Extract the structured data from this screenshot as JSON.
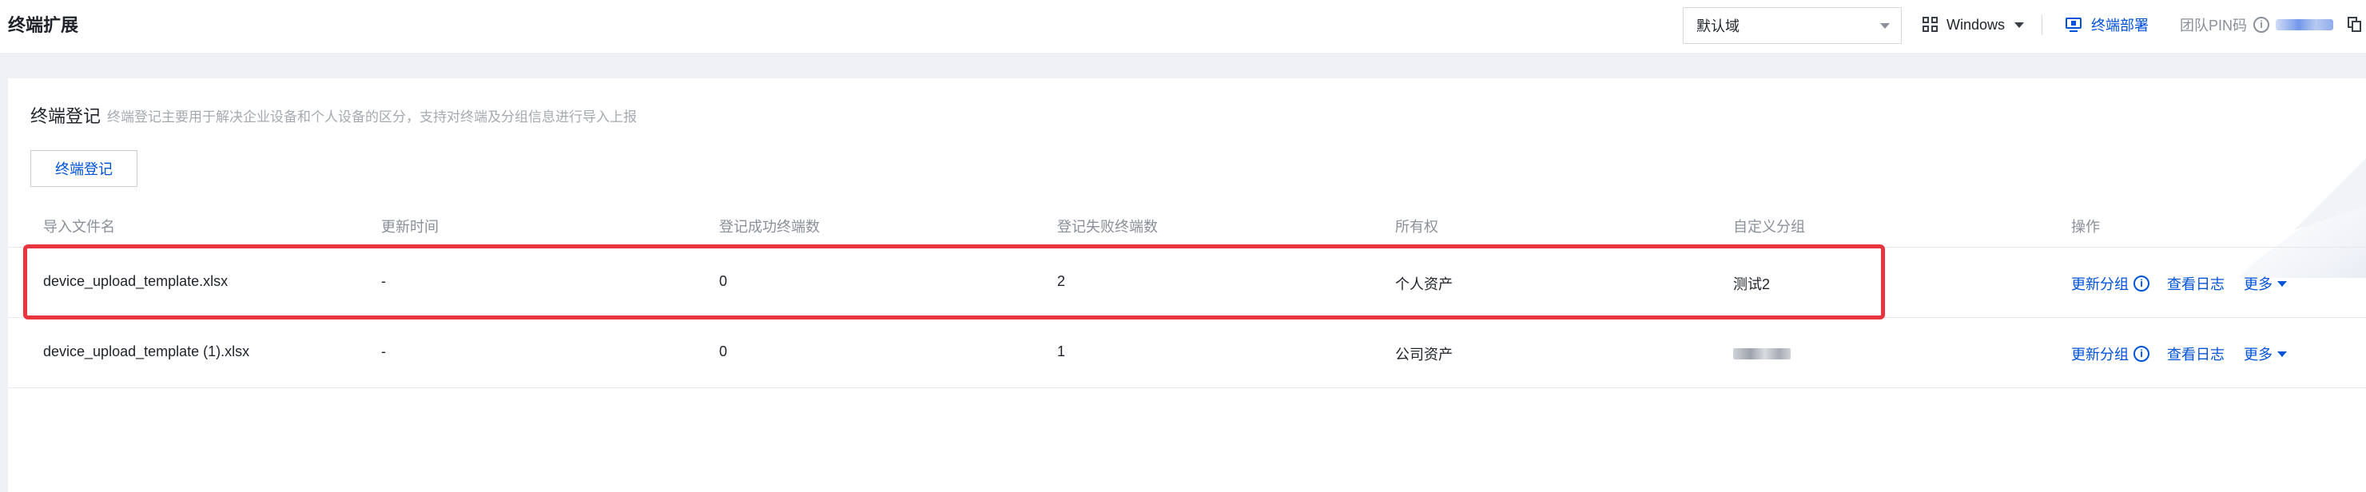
{
  "header": {
    "title": "终端扩展",
    "domain_select": {
      "value": "默认域"
    },
    "os_select": {
      "value": "Windows",
      "icon": "windows-icon"
    },
    "deploy_link": {
      "label": "终端部署",
      "icon": "monitor-icon"
    },
    "team_pin": {
      "label": "团队PIN码",
      "info_icon": "info-icon",
      "value_masked": true,
      "copy_icon": "copy-icon"
    }
  },
  "section": {
    "title": "终端登记",
    "description": "终端登记主要用于解决企业设备和个人设备的区分，支持对终端及分组信息进行导入上报",
    "register_button": "终端登记"
  },
  "table": {
    "columns": [
      "导入文件名",
      "更新时间",
      "登记成功终端数",
      "登记失败终端数",
      "所有权",
      "自定义分组",
      "操作"
    ],
    "rows": [
      {
        "filename": "device_upload_template.xlsx",
        "updated": "-",
        "success": "0",
        "failed": "2",
        "ownership": "个人资产",
        "group": "测试2",
        "group_masked": false,
        "actions": {
          "update_group": "更新分组",
          "view_log": "查看日志",
          "more": "更多"
        },
        "highlighted": true
      },
      {
        "filename": "device_upload_template (1).xlsx",
        "updated": "-",
        "success": "0",
        "failed": "1",
        "ownership": "公司资产",
        "group": "",
        "group_masked": true,
        "actions": {
          "update_group": "更新分组",
          "view_log": "查看日志",
          "more": "更多"
        },
        "highlighted": false
      }
    ]
  },
  "colors": {
    "accent": "#0052d9",
    "highlight_border": "#e8353e",
    "muted_text": "#8a8f99",
    "page_bg": "#eef0f4"
  }
}
